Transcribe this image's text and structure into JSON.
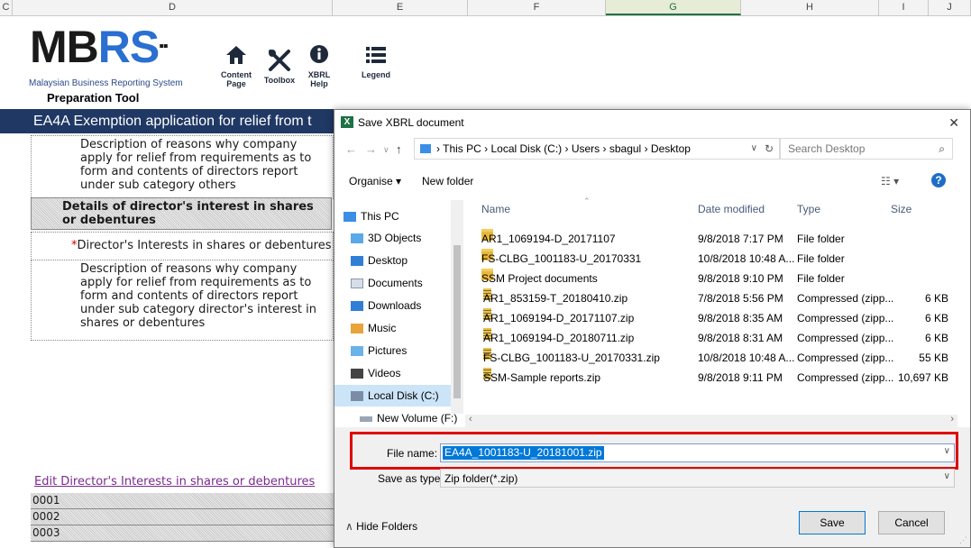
{
  "sheet": {
    "columns": [
      "C",
      "D",
      "E",
      "F",
      "G",
      "H",
      "I",
      "J"
    ],
    "selected_column": "G",
    "logo": {
      "text_m": "MB",
      "text_r": "RS",
      "tagline": "Malaysian Business Reporting System",
      "subtitle": "Preparation Tool"
    },
    "toolbar": [
      {
        "icon": "home-icon",
        "label": "Content\nPage"
      },
      {
        "icon": "toolbox-icon",
        "label": "Toolbox"
      },
      {
        "icon": "info-icon",
        "label": "XBRL\nHelp"
      },
      {
        "icon": "legend-icon",
        "label": "Legend"
      }
    ],
    "banner": "EA4A  Exemption application for relief from t",
    "desc1": "Description of reasons why company apply for relief from requirements as to form and contents of directors report under sub category others",
    "section_header": "Details of director's interest in shares or debentures",
    "required_mark": "*",
    "director_interests_label": "Director's Interests in shares or debentures",
    "desc2": "Description of reasons why company apply for relief from requirements as to form and contents of directors report under sub category director's interest in shares or debentures",
    "edit_link": "Edit Director's Interests in shares or debentures",
    "rows": [
      "0001",
      "0002",
      "0003"
    ]
  },
  "dialog": {
    "title": "Save XBRL document",
    "close": "✕",
    "breadcrumb": [
      "This PC",
      "Local Disk (C:)",
      "Users",
      "sbagul",
      "Desktop"
    ],
    "search_placeholder": "Search Desktop",
    "organise": "Organise ▾",
    "new_folder": "New folder",
    "nav": [
      "This PC",
      "3D Objects",
      "Desktop",
      "Documents",
      "Downloads",
      "Music",
      "Pictures",
      "Videos",
      "Local Disk (C:)",
      "New Volume (F:)"
    ],
    "nav_selected": "Local Disk (C:)",
    "columns": {
      "name": "Name",
      "date": "Date modified",
      "type": "Type",
      "size": "Size"
    },
    "files": [
      {
        "name": "AR1_1069194-D_20171107",
        "date": "9/8/2018 7:17 PM",
        "type": "File folder",
        "size": "",
        "kind": "folder"
      },
      {
        "name": "FS-CLBG_1001183-U_20170331",
        "date": "10/8/2018 10:48 A...",
        "type": "File folder",
        "size": "",
        "kind": "folder"
      },
      {
        "name": "SSM Project documents",
        "date": "9/8/2018 9:10 PM",
        "type": "File folder",
        "size": "",
        "kind": "folder"
      },
      {
        "name": "AR1_853159-T_20180410.zip",
        "date": "7/8/2018 5:56 PM",
        "type": "Compressed (zipp...",
        "size": "6 KB",
        "kind": "zip"
      },
      {
        "name": "AR1_1069194-D_20171107.zip",
        "date": "9/8/2018 8:35 AM",
        "type": "Compressed (zipp...",
        "size": "6 KB",
        "kind": "zip"
      },
      {
        "name": "AR1_1069194-D_20180711.zip",
        "date": "9/8/2018 8:31 AM",
        "type": "Compressed (zipp...",
        "size": "6 KB",
        "kind": "zip"
      },
      {
        "name": "FS-CLBG_1001183-U_20170331.zip",
        "date": "10/8/2018 10:48 A...",
        "type": "Compressed (zipp...",
        "size": "55 KB",
        "kind": "zip"
      },
      {
        "name": "SSM-Sample reports.zip",
        "date": "9/8/2018 9:11 PM",
        "type": "Compressed (zipp...",
        "size": "10,697 KB",
        "kind": "zip"
      }
    ],
    "file_name_label": "File name:",
    "file_name_value": "EA4A_1001183-U_20181001.zip",
    "save_type_label": "Save as type:",
    "save_type_value": "Zip folder(*.zip)",
    "hide_folders": "Hide Folders",
    "save": "Save",
    "cancel": "Cancel",
    "highlight_color": "#e00000"
  }
}
